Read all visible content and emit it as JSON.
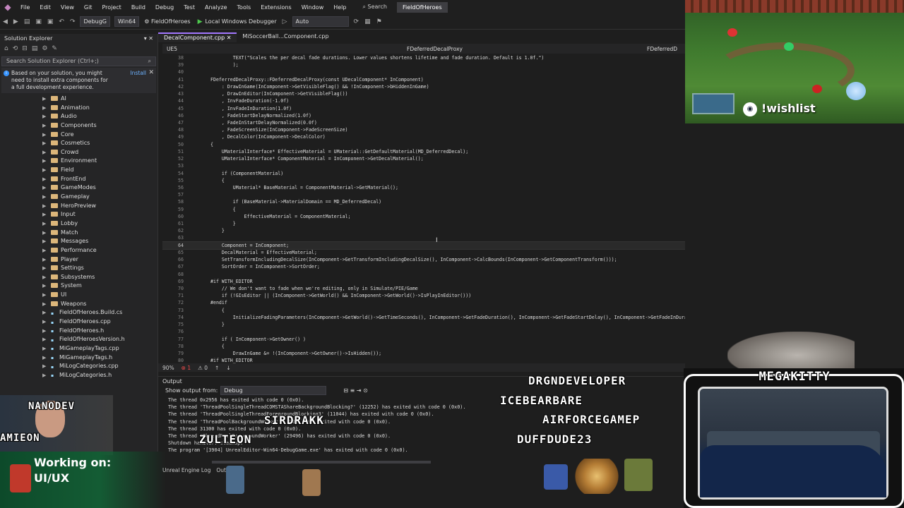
{
  "menu": {
    "items": [
      "File",
      "Edit",
      "View",
      "Git",
      "Project",
      "Build",
      "Debug",
      "Test",
      "Analyze",
      "Tools",
      "Extensions",
      "Window",
      "Help"
    ],
    "search": "Search",
    "solution_title": "FieldOfHeroes"
  },
  "toolbar": {
    "config": "DebugG",
    "platform": "Win64",
    "startup_project": "FieldOfHeroes",
    "debugger": "Local Windows Debugger",
    "auto": "Auto"
  },
  "solution_explorer": {
    "title": "Solution Explorer",
    "search_placeholder": "Search Solution Explorer (Ctrl+;)",
    "notice": "Based on your solution, you might need to install extra components for a full development experience.",
    "install": "Install",
    "items": [
      {
        "label": "AI",
        "type": "folder"
      },
      {
        "label": "Animation",
        "type": "folder"
      },
      {
        "label": "Audio",
        "type": "folder"
      },
      {
        "label": "Components",
        "type": "folder"
      },
      {
        "label": "Core",
        "type": "folder"
      },
      {
        "label": "Cosmetics",
        "type": "folder"
      },
      {
        "label": "Crowd",
        "type": "folder"
      },
      {
        "label": "Environment",
        "type": "folder"
      },
      {
        "label": "Field",
        "type": "folder"
      },
      {
        "label": "FrontEnd",
        "type": "folder"
      },
      {
        "label": "GameModes",
        "type": "folder"
      },
      {
        "label": "Gameplay",
        "type": "folder"
      },
      {
        "label": "HeroPreview",
        "type": "folder"
      },
      {
        "label": "Input",
        "type": "folder"
      },
      {
        "label": "Lobby",
        "type": "folder"
      },
      {
        "label": "Match",
        "type": "folder"
      },
      {
        "label": "Messages",
        "type": "folder"
      },
      {
        "label": "Performance",
        "type": "folder"
      },
      {
        "label": "Player",
        "type": "folder"
      },
      {
        "label": "Settings",
        "type": "folder"
      },
      {
        "label": "Subsystems",
        "type": "folder"
      },
      {
        "label": "System",
        "type": "folder"
      },
      {
        "label": "UI",
        "type": "folder"
      },
      {
        "label": "Weapons",
        "type": "folder"
      },
      {
        "label": "FieldOfHeroes.Build.cs",
        "type": "file"
      },
      {
        "label": "FieldOfHeroes.cpp",
        "type": "file"
      },
      {
        "label": "FieldOfHeroes.h",
        "type": "file"
      },
      {
        "label": "FieldOfHeroesVersion.h",
        "type": "file"
      },
      {
        "label": "MiGameplayTags.cpp",
        "type": "file"
      },
      {
        "label": "MiGameplayTags.h",
        "type": "file"
      },
      {
        "label": "MiLogCategories.cpp",
        "type": "file"
      },
      {
        "label": "MiLogCategories.h",
        "type": "file"
      }
    ]
  },
  "editor": {
    "tabs": [
      "DecalComponent.cpp",
      "MiSoccerBall...Component.cpp"
    ],
    "nav": [
      "UE5",
      "FDeferredDecalProxy",
      "FDeferredD"
    ],
    "zoom": "90%",
    "errors": "1",
    "warnings": "0",
    "current_line": "64",
    "lines": [
      {
        "n": "38",
        "t": "        TEXT(\"Scales the per decal fade durations. Lower values shortens lifetime and fade duration. Default is 1.0f.\")"
      },
      {
        "n": "39",
        "t": "        );"
      },
      {
        "n": "40",
        "t": ""
      },
      {
        "n": "41",
        "t": "FDeferredDecalProxy::FDeferredDecalProxy(const UDecalComponent* InComponent)"
      },
      {
        "n": "42",
        "t": "    : DrawInGame(InComponent->GetVisibleFlag() && !InComponent->bHiddenInGame)"
      },
      {
        "n": "43",
        "t": "    , DrawInEditor(InComponent->GetVisibleFlag())"
      },
      {
        "n": "44",
        "t": "    , InvFadeDuration(-1.0f)"
      },
      {
        "n": "45",
        "t": "    , InvFadeInDuration(1.0f)"
      },
      {
        "n": "46",
        "t": "    , FadeStartDelayNormalized(1.0f)"
      },
      {
        "n": "47",
        "t": "    , FadeInStartDelayNormalized(0.0f)"
      },
      {
        "n": "48",
        "t": "    , FadeScreenSize(InComponent->FadeScreenSize)"
      },
      {
        "n": "49",
        "t": "    , DecalColor(InComponent->DecalColor)"
      },
      {
        "n": "50",
        "t": "{"
      },
      {
        "n": "51",
        "t": "    UMaterialInterface* EffectiveMaterial = UMaterial::GetDefaultMaterial(MD_DeferredDecal);"
      },
      {
        "n": "52",
        "t": "    UMaterialInterface* ComponentMaterial = InComponent->GetDecalMaterial();"
      },
      {
        "n": "53",
        "t": ""
      },
      {
        "n": "54",
        "t": "    if (ComponentMaterial)"
      },
      {
        "n": "55",
        "t": "    {"
      },
      {
        "n": "56",
        "t": "        UMaterial* BaseMaterial = ComponentMaterial->GetMaterial();"
      },
      {
        "n": "57",
        "t": ""
      },
      {
        "n": "58",
        "t": "        if (BaseMaterial->MaterialDomain == MD_DeferredDecal)"
      },
      {
        "n": "59",
        "t": "        {"
      },
      {
        "n": "60",
        "t": "            EffectiveMaterial = ComponentMaterial;"
      },
      {
        "n": "61",
        "t": "        }"
      },
      {
        "n": "62",
        "t": "    }"
      },
      {
        "n": "63",
        "t": ""
      },
      {
        "n": "64",
        "t": "    Component = InComponent;"
      },
      {
        "n": "65",
        "t": "    DecalMaterial = EffectiveMaterial;"
      },
      {
        "n": "66",
        "t": "    SetTransformIncludingDecalSize(InComponent->GetTransformIncludingDecalSize(), InComponent->CalcBounds(InComponent->GetComponentTransform()));"
      },
      {
        "n": "67",
        "t": "    SortOrder = InComponent->SortOrder;"
      },
      {
        "n": "68",
        "t": ""
      },
      {
        "n": "69",
        "t": "#if WITH_EDITOR"
      },
      {
        "n": "70",
        "t": "    // We don't want to fade when we're editing, only in Simulate/PIE/Game"
      },
      {
        "n": "71",
        "t": "    if (!GIsEditor || (InComponent->GetWorld() && InComponent->GetWorld()->IsPlayInEditor()))"
      },
      {
        "n": "72",
        "t": "#endif"
      },
      {
        "n": "73",
        "t": "    {"
      },
      {
        "n": "74",
        "t": "        InitializeFadingParameters(InComponent->GetWorld()->GetTimeSeconds(), InComponent->GetFadeDuration(), InComponent->GetFadeStartDelay(), InComponent->GetFadeInDuration(), InComponent->GetFadeInStartDelay());"
      },
      {
        "n": "75",
        "t": "    }"
      },
      {
        "n": "76",
        "t": ""
      },
      {
        "n": "77",
        "t": "    if ( InComponent->GetOwner() )"
      },
      {
        "n": "78",
        "t": "    {"
      },
      {
        "n": "79",
        "t": "        DrawInGame &= !(InComponent->GetOwner()->IsHidden());"
      },
      {
        "n": "80",
        "t": "#if WITH_EDITOR"
      }
    ]
  },
  "output": {
    "title": "Output",
    "show_from_label": "Show output from:",
    "show_from_value": "Debug",
    "lines": [
      "The thread 0x2956 has exited with code 0 (0x0).",
      "The thread 'ThreadPoolSingleThreadCOMSTAShareBackgroundBlocking?' (12252) has exited with code 0 (0x0).",
      "The thread 'ThreadPoolSingleThreadForegroundBlocking3' (11044) has exited with code 0 (0x0).",
      "The thread 'ThreadPoolBackgroundWorker' (30124) has exited with code 0 (0x0).",
      "The thread 31300 has exited with code 0 (0x0).",
      "The thread 'ThreadPoolForegroundWorker' (29496) has exited with code 0 (0x0).",
      "Shutdown handler: cleanup.",
      "The program '[3904] UnrealEditor-Win64-DebugGame.exe' has exited with code 0 (0x0)."
    ],
    "bottom_tabs": [
      "Unreal Engine Log",
      "Output"
    ]
  },
  "stream": {
    "wishlist": "!wishlist",
    "cam_title": "MEGAKITTY",
    "streamer_name": "NANODEV",
    "working_on_line1": "Working on:",
    "working_on_line2": "UI/UX",
    "sub_names": [
      "DRGNDEVELOPER",
      "ICEBEARBARE",
      "AIRFORCEGAMEP",
      "DUFFDUDE23",
      "SIRDRAKK",
      "ZULTEON",
      "AMIEON"
    ]
  },
  "colors": {
    "accent": "#a277ff",
    "error": "#f14c4c",
    "keyword": "#569cd6",
    "type": "#4ec9b0",
    "banner_green": "#145c34"
  }
}
